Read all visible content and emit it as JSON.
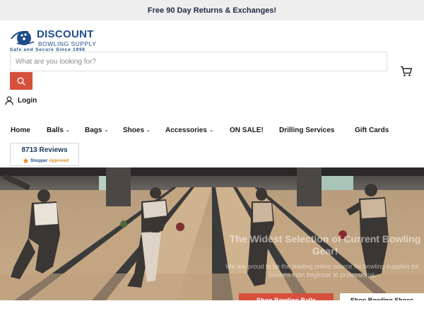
{
  "announcement": "Free 90 Day Returns & Exchanges!",
  "logo": {
    "line1": "DISCOUNT",
    "line2": "BOWLING SUPPLY",
    "tagline": "Safe and Secure Since 1996"
  },
  "search": {
    "placeholder": "What are you looking for?",
    "icon": "search-icon"
  },
  "cart": {
    "icon": "cart-icon"
  },
  "account": {
    "label": "Login",
    "icon": "user-icon"
  },
  "nav": {
    "items": [
      {
        "label": "Home"
      },
      {
        "label": "Balls"
      },
      {
        "label": "Bags"
      },
      {
        "label": "Shoes"
      },
      {
        "label": "Accessories"
      },
      {
        "label": "ON SALE!"
      },
      {
        "label": "Drilling Services"
      },
      {
        "label": "Gift Cards"
      }
    ]
  },
  "reviews": {
    "count": "8713 Reviews",
    "badge_word1": "Shopper",
    "badge_word2": "Approved"
  },
  "hero": {
    "title": "The Widest Selection of Current Bowling Gear!",
    "subtitle": "We are proud to be the leading online source for bowling supplies for bowlers from beginner to professional.",
    "button_primary": "Shop Bowling Balls",
    "button_secondary": "Shop Bowling Shoes"
  },
  "colors": {
    "brand_blue": "#1e4d8c",
    "accent_red": "#d6503c",
    "announcement_bg": "#eeeeee"
  }
}
